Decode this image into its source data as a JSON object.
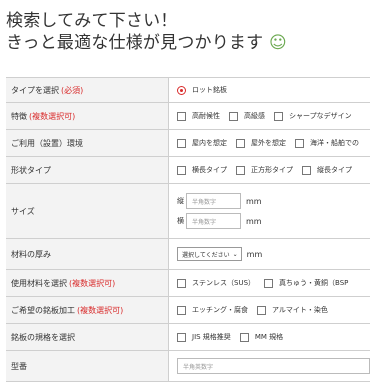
{
  "headline": {
    "line1": "検索してみて下さい！",
    "line2": "きっと最適な仕様が見つかります",
    "emoji": "☺"
  },
  "form": {
    "type": {
      "label": "タイプを選択",
      "req": "(必須)",
      "option": "ロット銘板"
    },
    "feature": {
      "label": "特徴",
      "req": "(複数選択可)",
      "options": [
        "高耐候性",
        "高級感",
        "シャープなデザイン"
      ]
    },
    "env": {
      "label": "ご利用（設置）環境",
      "options": [
        "屋内を想定",
        "屋外を想定",
        "海洋・船舶での"
      ]
    },
    "shape": {
      "label": "形状タイプ",
      "options": [
        "横長タイプ",
        "正方形タイプ",
        "縦長タイプ"
      ]
    },
    "size": {
      "label": "サイズ",
      "height_label": "縦",
      "width_label": "横",
      "placeholder": "半角数字",
      "unit": "mm"
    },
    "thickness": {
      "label": "材料の厚み",
      "select": "選択してください",
      "unit": "mm"
    },
    "material": {
      "label": "使用材料を選択",
      "req": "(複数選択可)",
      "options": [
        "ステンレス（SUS）",
        "真ちゅう・黄銅（BSP"
      ]
    },
    "process": {
      "label": "ご希望の銘板加工",
      "req": "(複数選択可)",
      "options": [
        "エッチング・腐食",
        "アルマイト・染色"
      ]
    },
    "standard": {
      "label": "銘板の規格を選択",
      "options": [
        "JIS 規格推奨",
        "MM 規格"
      ]
    },
    "model": {
      "label": "型番",
      "placeholder": "半角英数字"
    }
  }
}
